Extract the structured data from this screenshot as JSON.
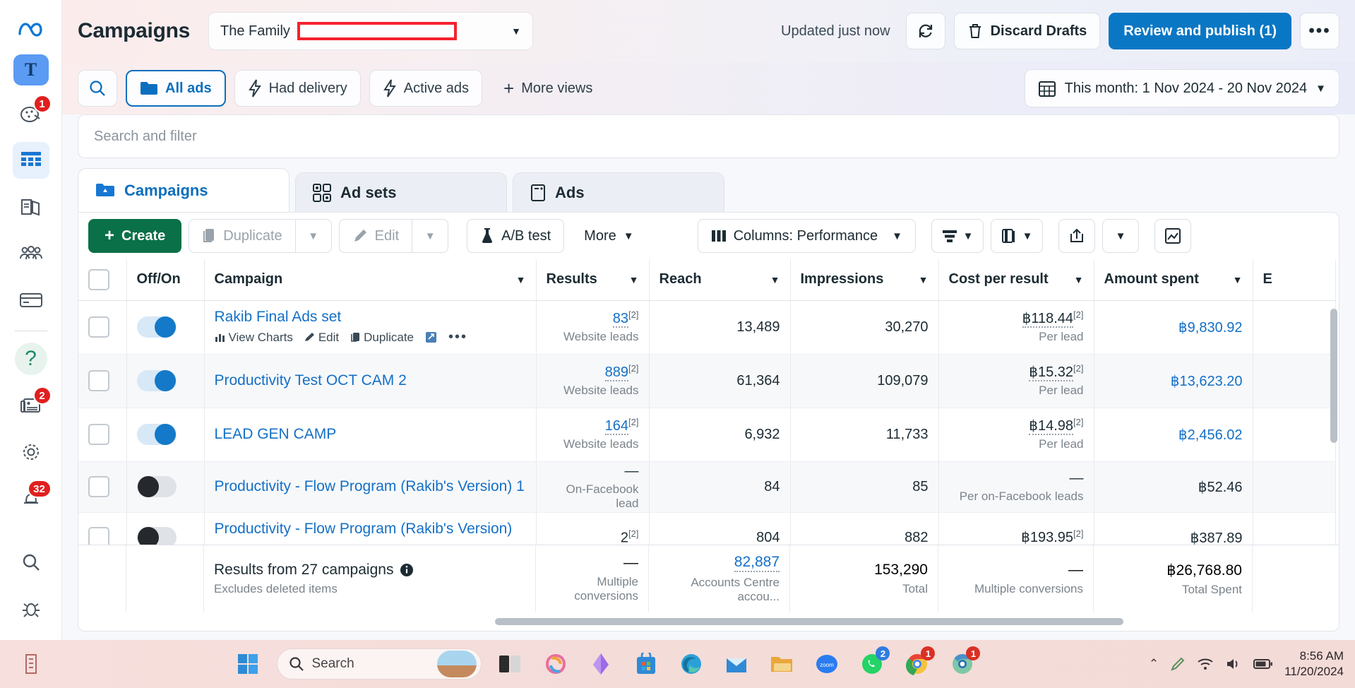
{
  "rail": {
    "logo": "meta-logo",
    "avatar_letter": "T",
    "items": [
      {
        "name": "ads-manager-face-icon",
        "badge": "1"
      },
      {
        "name": "campaigns-table-icon",
        "badge": ""
      },
      {
        "name": "library-icon",
        "badge": ""
      },
      {
        "name": "audiences-people-icon",
        "badge": ""
      },
      {
        "name": "billing-card-icon",
        "badge": ""
      }
    ],
    "help_glyph": "?",
    "news_badge": "2",
    "bell_badge": "32"
  },
  "header": {
    "title": "Campaigns",
    "account_name": "The Family",
    "updated_text": "Updated just now",
    "refresh_label": "refresh-icon",
    "discard_label": "Discard Drafts",
    "publish_label": "Review and publish (1)",
    "overflow_label": "•••"
  },
  "views": {
    "search_icon": "search-icon",
    "buttons": [
      {
        "label": "All ads",
        "icon": "folder-icon",
        "selected": true
      },
      {
        "label": "Had delivery",
        "icon": "bolt-icon",
        "selected": false
      },
      {
        "label": "Active ads",
        "icon": "bolt-icon",
        "selected": false
      }
    ],
    "more_views": "More views",
    "date_range": "This month: 1 Nov 2024 - 20 Nov 2024"
  },
  "search_filter": {
    "placeholder": "Search and filter"
  },
  "tabs": [
    {
      "label": "Campaigns",
      "icon": "campaigns-folder-icon",
      "active": true
    },
    {
      "label": "Ad sets",
      "icon": "ad-sets-grid-icon",
      "active": false
    },
    {
      "label": "Ads",
      "icon": "ads-card-icon",
      "active": false
    }
  ],
  "actions": {
    "create": "Create",
    "duplicate": "Duplicate",
    "edit": "Edit",
    "ab_test": "A/B test",
    "more": "More",
    "columns": "Columns: Performance",
    "breakdown_icon": "breakdown-icon",
    "reports_icon": "reports-icon",
    "export_icon": "export-icon",
    "charts_icon": "charts-icon"
  },
  "table": {
    "columns": [
      {
        "label": "Off/On",
        "sortable": false,
        "align": "left"
      },
      {
        "label": "Campaign",
        "sortable": true,
        "align": "left"
      },
      {
        "label": "Results",
        "sortable": true,
        "align": "right"
      },
      {
        "label": "Reach",
        "sortable": true,
        "align": "right"
      },
      {
        "label": "Impressions",
        "sortable": true,
        "align": "right"
      },
      {
        "label": "Cost per result",
        "sortable": true,
        "align": "right"
      },
      {
        "label": "Amount spent",
        "sortable": true,
        "align": "right"
      },
      {
        "label": "E",
        "sortable": false,
        "align": "right"
      }
    ],
    "row_actions": [
      "View Charts",
      "Edit",
      "Duplicate"
    ],
    "rows": [
      {
        "toggle": "on",
        "campaign": "Rakib Final Ads set",
        "has_actions": true,
        "results": "83",
        "results_sup": "[2]",
        "results_sub": "Website leads",
        "reach": "13,489",
        "impressions": "30,270",
        "cost_per_result": "฿118.44",
        "cost_sup": "[2]",
        "cost_sub": "Per lead",
        "amount_spent": "฿9,830.92"
      },
      {
        "toggle": "on",
        "campaign": "Productivity Test OCT CAM 2",
        "has_actions": false,
        "results": "889",
        "results_sup": "[2]",
        "results_sub": "Website leads",
        "reach": "61,364",
        "impressions": "109,079",
        "cost_per_result": "฿15.32",
        "cost_sup": "[2]",
        "cost_sub": "Per lead",
        "amount_spent": "฿13,623.20"
      },
      {
        "toggle": "on",
        "campaign": "LEAD GEN CAMP",
        "has_actions": false,
        "results": "164",
        "results_sup": "[2]",
        "results_sub": "Website leads",
        "reach": "6,932",
        "impressions": "11,733",
        "cost_per_result": "฿14.98",
        "cost_sup": "[2]",
        "cost_sub": "Per lead",
        "amount_spent": "฿2,456.02"
      },
      {
        "toggle": "off",
        "campaign": "Productivity - Flow Program (Rakib's Version) 1",
        "has_actions": false,
        "results": "—",
        "results_sup": "",
        "results_sub": "On-Facebook lead",
        "reach": "84",
        "impressions": "85",
        "cost_per_result": "—",
        "cost_sup": "",
        "cost_sub": "Per on-Facebook leads",
        "amount_spent": "฿52.46"
      },
      {
        "toggle": "off",
        "campaign": "Productivity - Flow Program (Rakib's Version) –...",
        "has_actions": false,
        "results": "2",
        "results_sup": "[2]",
        "results_sub": "",
        "reach": "804",
        "impressions": "882",
        "cost_per_result": "฿193.95",
        "cost_sup": "[2]",
        "cost_sub": "",
        "amount_spent": "฿387.89"
      }
    ],
    "summary": {
      "title": "Results from 27 campaigns",
      "subtitle": "Excludes deleted items",
      "results": "—",
      "results_sub": "Multiple conversions",
      "reach": "82,887",
      "reach_sub": "Accounts Centre accou...",
      "impressions": "153,290",
      "impressions_sub": "Total",
      "cost_per_result": "—",
      "cost_sub": "Multiple conversions",
      "amount_spent": "฿26,768.80",
      "amount_sub": "Total Spent"
    }
  },
  "taskbar": {
    "start_icon": "windows-start-icon",
    "search_placeholder": "Search",
    "apps": [
      {
        "name": "task-view-icon",
        "badge": ""
      },
      {
        "name": "copilot-icon",
        "badge": ""
      },
      {
        "name": "crystal-app-icon",
        "badge": ""
      },
      {
        "name": "microsoft-store-icon",
        "badge": ""
      },
      {
        "name": "edge-icon",
        "badge": ""
      },
      {
        "name": "mail-icon",
        "badge": ""
      },
      {
        "name": "file-explorer-icon",
        "badge": ""
      },
      {
        "name": "zoom-icon",
        "badge": ""
      },
      {
        "name": "whatsapp-icon",
        "badge": "2"
      },
      {
        "name": "chrome-icon",
        "badge": "1"
      },
      {
        "name": "chrome-beta-icon",
        "badge": "1"
      }
    ],
    "tray": [
      "chevron-up-icon",
      "pen-icon",
      "wifi-icon",
      "volume-icon",
      "battery-icon"
    ],
    "time": "8:56 AM",
    "date": "11/20/2024"
  }
}
